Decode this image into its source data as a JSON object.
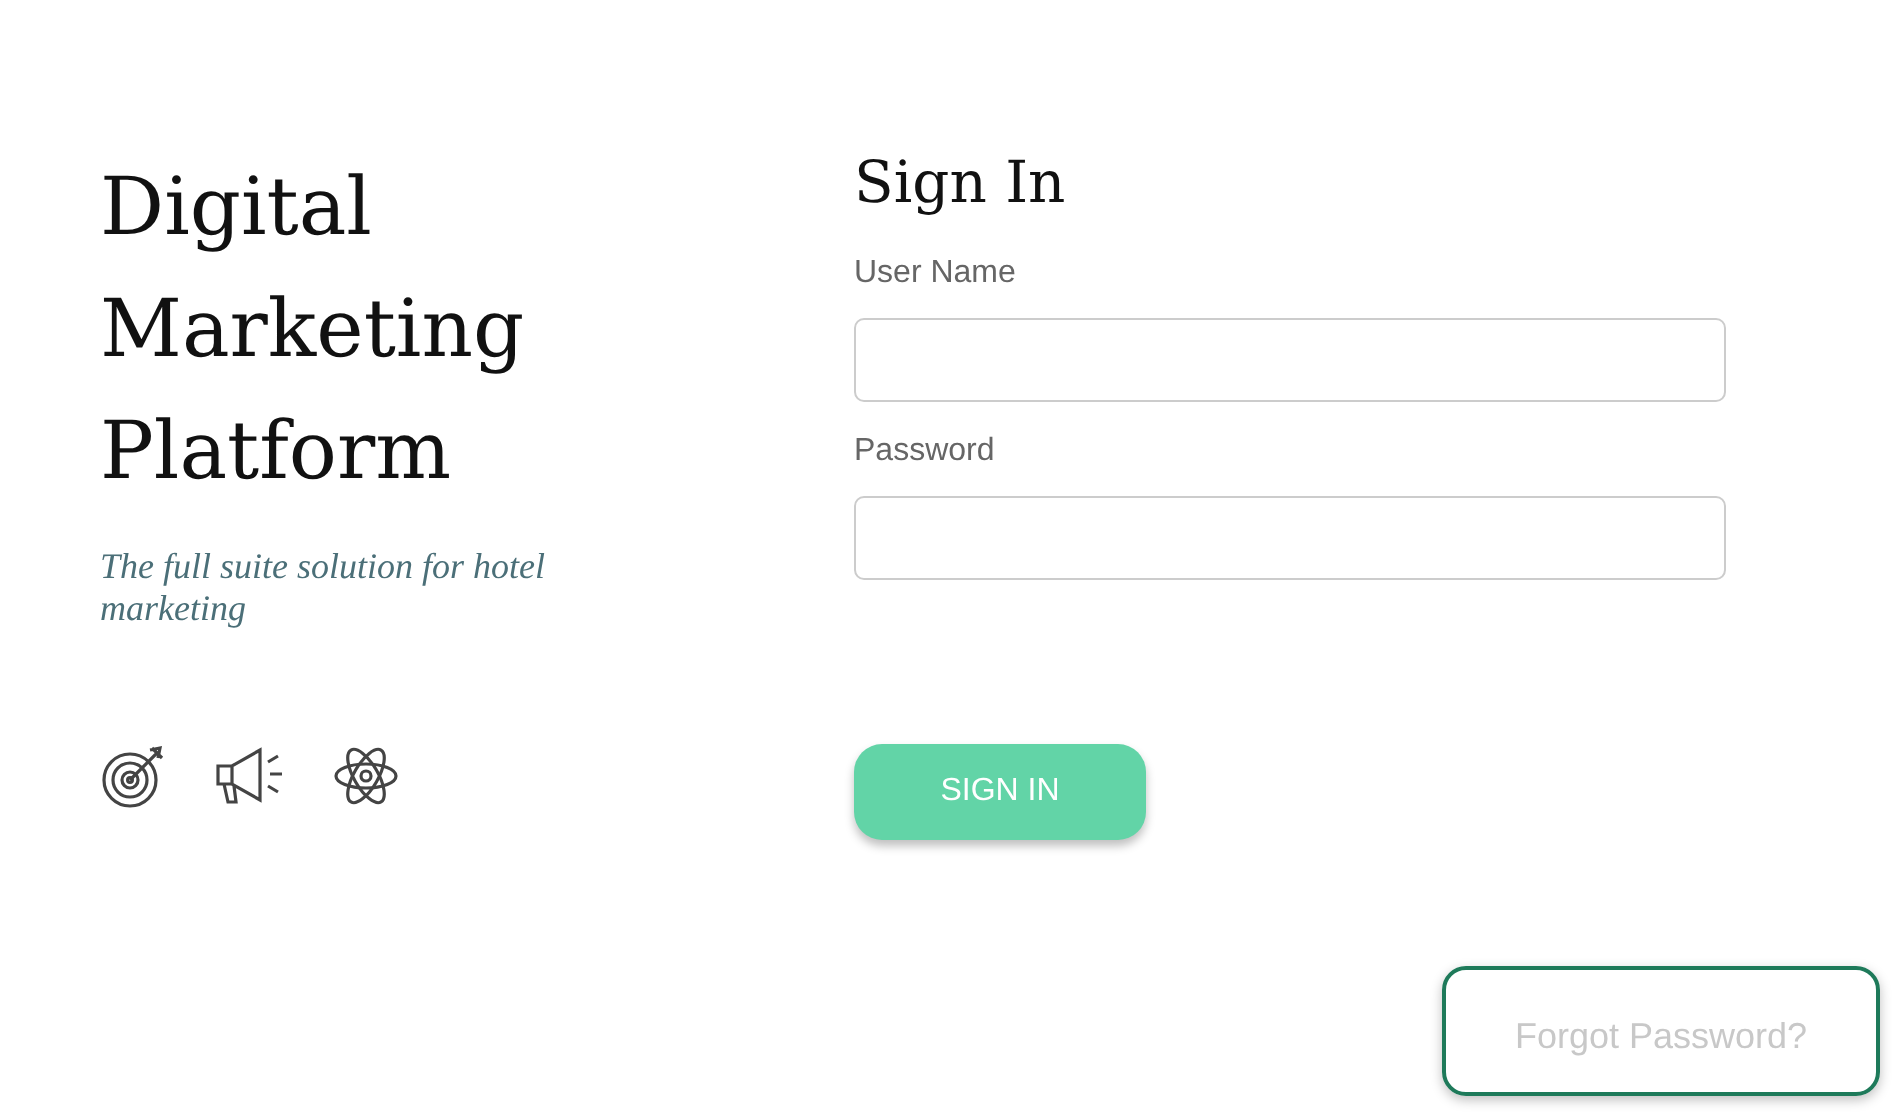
{
  "brand": {
    "title_lines": [
      "Digital",
      "Marketing",
      "Platform"
    ],
    "tagline": "The full suite solution for hotel marketing",
    "icons": [
      {
        "kind": "target"
      },
      {
        "kind": "megaphone"
      },
      {
        "kind": "atom"
      }
    ]
  },
  "form": {
    "title": "Sign In",
    "fields": [
      {
        "label": "User Name"
      },
      {
        "label": "Password"
      }
    ],
    "submit": "SIGN IN"
  },
  "forgot_link": "Forgot Password?"
}
